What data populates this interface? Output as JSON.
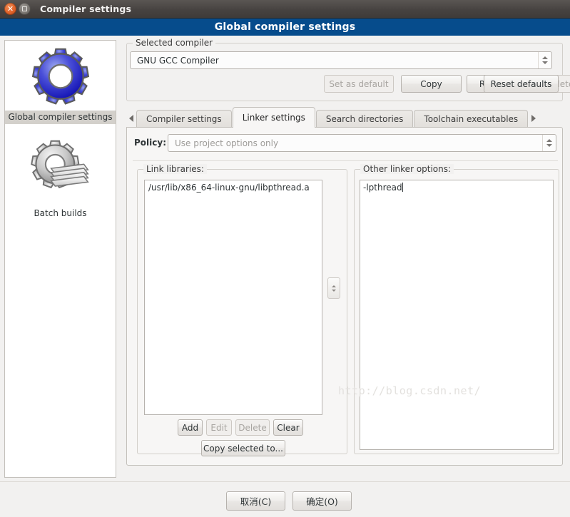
{
  "window": {
    "title": "Compiler settings",
    "close_icon": "close-icon",
    "maximize_icon": "maximize-icon"
  },
  "banner": {
    "title": "Global compiler settings",
    "bg": "#064c8c",
    "fg": "#ffffff"
  },
  "sidebar": {
    "items": [
      {
        "label": "Global compiler settings",
        "icon": "blue-gear-icon",
        "selected": true
      },
      {
        "label": "Batch builds",
        "icon": "gray-gear-stack-icon",
        "selected": false
      }
    ]
  },
  "compiler_group": {
    "title": "Selected compiler",
    "combo_value": "GNU GCC Compiler",
    "buttons": [
      {
        "label": "Set as default",
        "enabled": false
      },
      {
        "label": "Copy",
        "enabled": true
      },
      {
        "label": "Rename",
        "enabled": true
      },
      {
        "label": "Delete",
        "enabled": false
      },
      {
        "label": "Reset defaults",
        "enabled": true
      }
    ]
  },
  "tabs": {
    "scroll_left_icon": "chevron-left-icon",
    "scroll_right_icon": "chevron-right-icon",
    "items": [
      {
        "label": "Compiler settings",
        "active": false
      },
      {
        "label": "Linker settings",
        "active": true
      },
      {
        "label": "Search directories",
        "active": false
      },
      {
        "label": "Toolchain executables",
        "active": false
      }
    ]
  },
  "linker_page": {
    "policy_label": "Policy:",
    "policy_value": "Use project options only",
    "policy_enabled": false,
    "link_libraries": {
      "title": "Link libraries:",
      "items": [
        "/usr/lib/x86_64-linux-gnu/libpthread.a"
      ],
      "buttons": [
        {
          "label": "Add",
          "enabled": true
        },
        {
          "label": "Edit",
          "enabled": false
        },
        {
          "label": "Delete",
          "enabled": false
        },
        {
          "label": "Clear",
          "enabled": true
        }
      ],
      "copy_selected_label": "Copy selected to..."
    },
    "other_linker_options": {
      "title": "Other linker options:",
      "value": "-lpthread"
    }
  },
  "watermark": "http://blog.csdn.net/",
  "actions": {
    "cancel_label": "取消(C)",
    "ok_label": "确定(O)"
  }
}
